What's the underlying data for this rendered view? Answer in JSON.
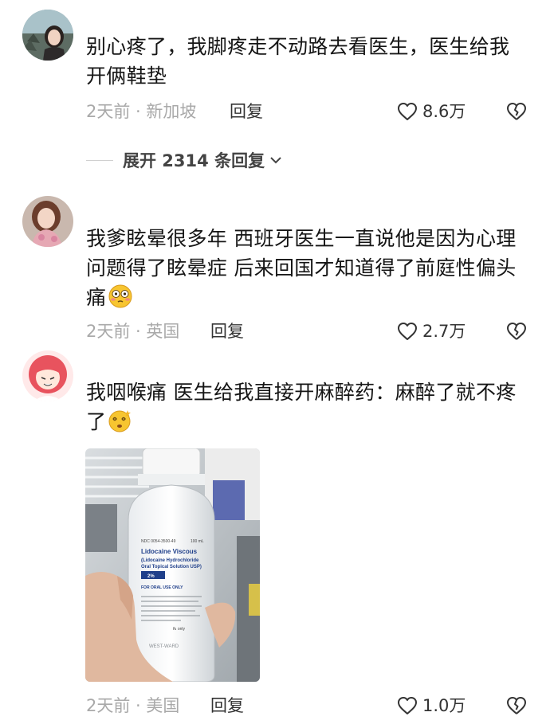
{
  "comments": [
    {
      "text": "别心疼了，我脚疼走不动路去看医生，医生给我开俩鞋垫",
      "time": "2天前",
      "location": "新加坡",
      "reply_label": "回复",
      "likes": "8.6万"
    },
    {
      "text": "我爹眩晕很多年 西班牙医生一直说他是因为心理问题得了眩晕症 后来回国才知道得了前庭性偏头痛",
      "time": "2天前",
      "location": "英国",
      "reply_label": "回复",
      "likes": "2.7万"
    },
    {
      "text": "我咽喉痛 医生给我直接开麻醉药：麻醉了就不疼了",
      "time": "2天前",
      "location": "美国",
      "reply_label": "回复",
      "likes": "1.0万"
    }
  ],
  "expand_replies": {
    "label": "展开 2314 条回复"
  },
  "photo_label": {
    "ndc": "NDC 0054-3500-49",
    "volume": "100 mL",
    "name": "Lidocaine Viscous",
    "subtitle_1": "(Lidocaine Hydrochloride",
    "subtitle_2": "Oral Topical Solution USP)",
    "strength": "2%",
    "oral_use": "FOR ORAL USE ONLY",
    "rx": "℞ only",
    "brand": "WEST-WARD"
  },
  "colors": {
    "meta_gray": "#a9a9a9",
    "text": "#151515",
    "action": "#333333"
  },
  "icons": {
    "like": "heart-outline-icon",
    "dislike": "broken-heart-icon",
    "expand": "chevron-down-icon",
    "emoji_1": "flushed-face-icon",
    "emoji_2": "dizzy-face-icon"
  }
}
